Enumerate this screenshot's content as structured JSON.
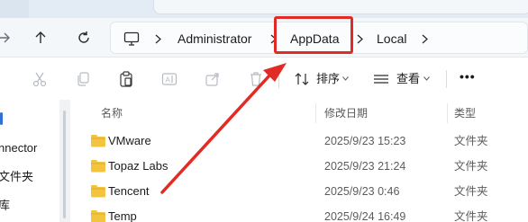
{
  "address": {
    "crumbs": [
      "Administrator",
      "AppData",
      "Local"
    ]
  },
  "toolbar": {
    "sort_label": "排序",
    "view_label": "查看",
    "more_label": "•••"
  },
  "columns": {
    "name": "名称",
    "date": "修改日期",
    "type": "类型"
  },
  "nav_pane": {
    "items": [
      "nnector",
      "文件夹",
      "库"
    ]
  },
  "files": [
    {
      "name": "VMware",
      "date": "2025/9/23 15:23",
      "type": "文件夹"
    },
    {
      "name": "Topaz Labs",
      "date": "2025/9/23 21:24",
      "type": "文件夹"
    },
    {
      "name": "Tencent",
      "date": "2025/9/23 0:46",
      "type": "文件夹"
    },
    {
      "name": "Temp",
      "date": "2025/9/24 16:49",
      "type": "文件夹"
    }
  ],
  "colors": {
    "annotation": "#e22b25",
    "folder": "#f3c43f",
    "accent": "#2f6fd6"
  }
}
